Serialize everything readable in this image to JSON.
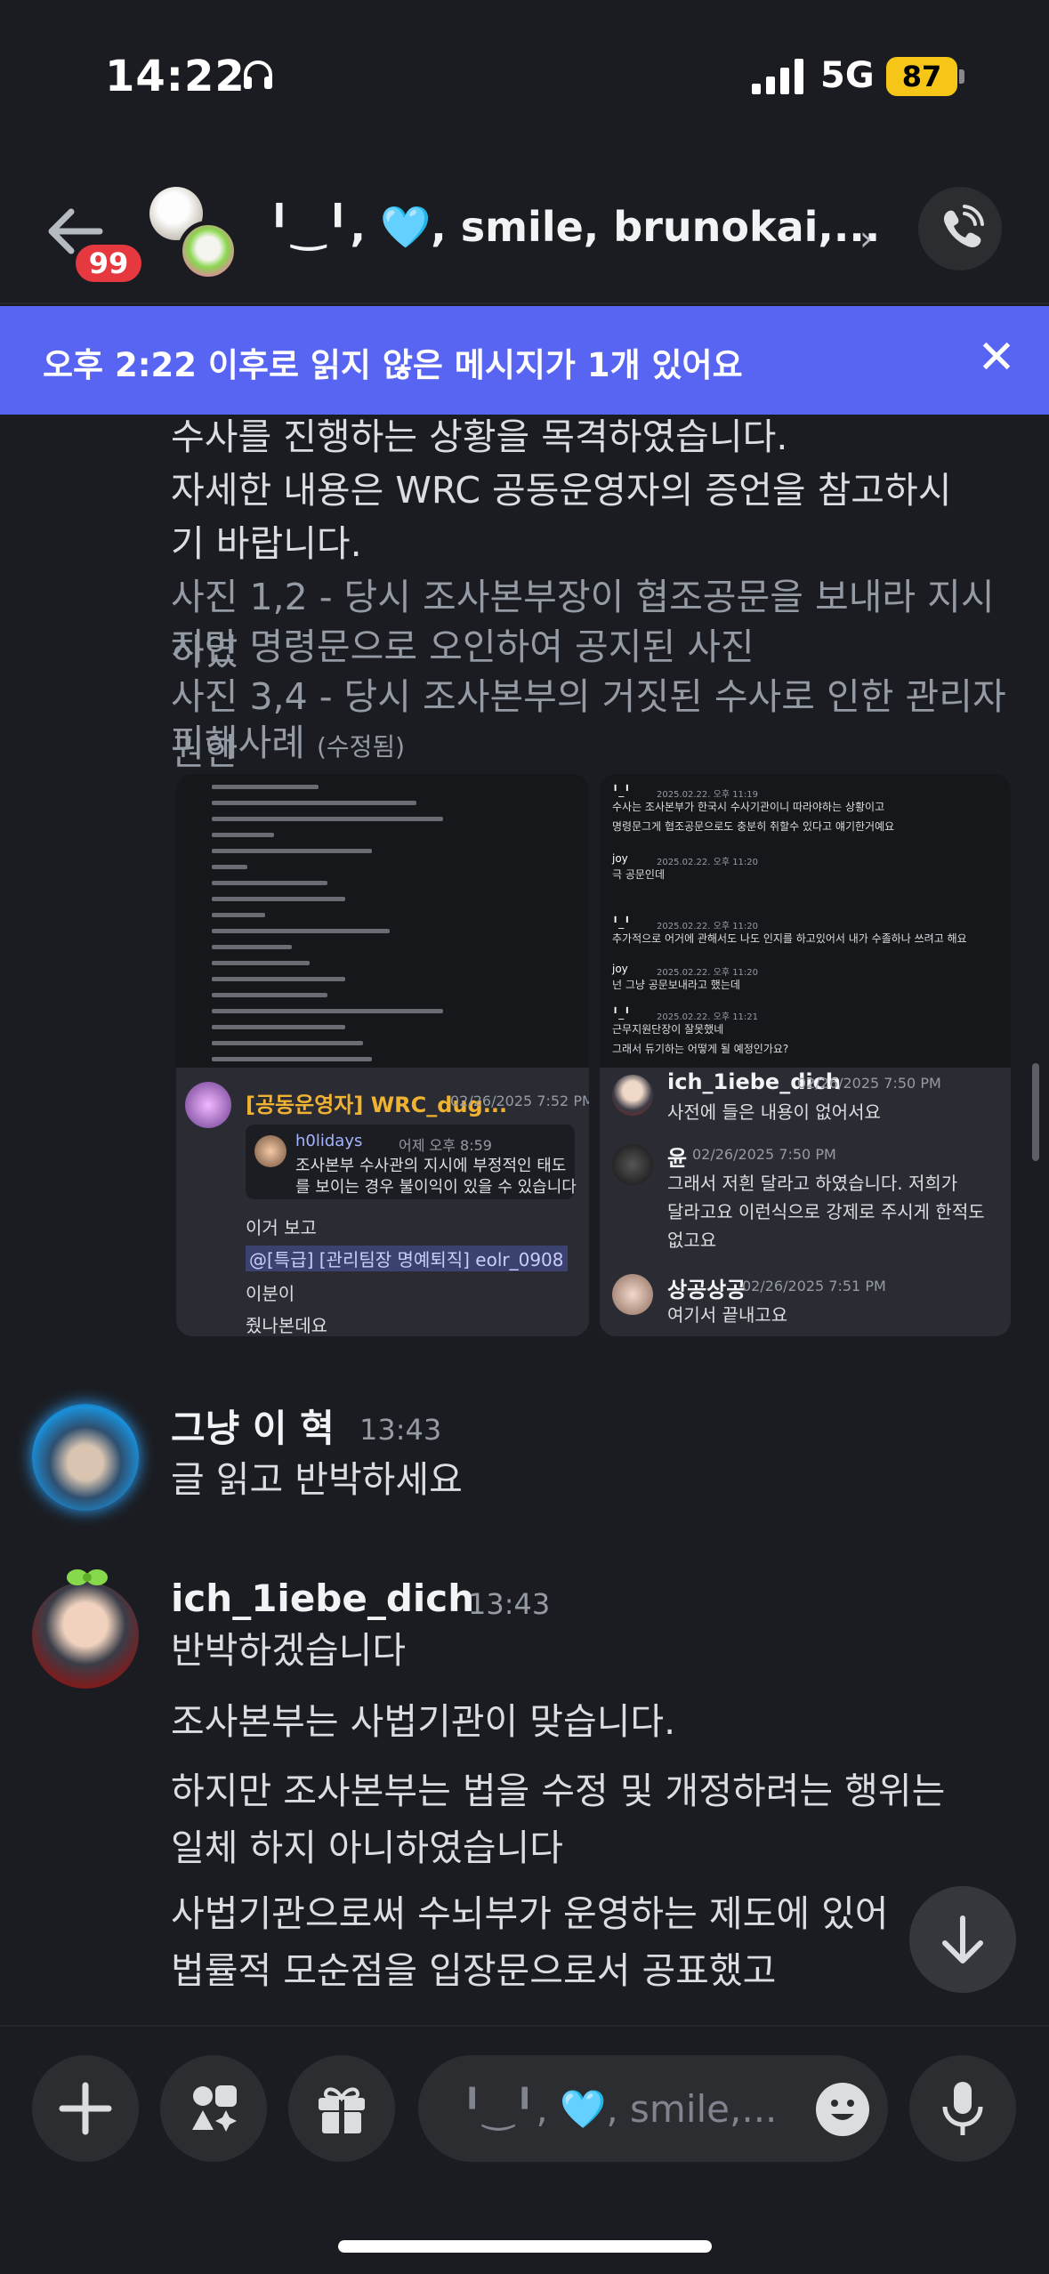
{
  "status_bar": {
    "time": "14:22",
    "network": "5G",
    "battery": "87"
  },
  "header": {
    "unread_badge": "99",
    "title": "╹‿╹, 🩵, smile, brunokai,...",
    "chevron": "›"
  },
  "unread_banner": {
    "text": "오후 2:22 이후로 읽지 않은 메시지가 1개 있어요",
    "close": "✕"
  },
  "previous_message": {
    "lines": [
      "수사를 진행하는 상황을 목격하였습니다.",
      "자세한 내용은 WRC 공동운영자의 증언을 참고하시",
      "기 바랍니다."
    ],
    "muted_lines": [
      "사진 1,2 - 당시 조사본부장이 협조공문을 보내라 지시하였",
      "지만 명령문으로 오인하여 공지된 사진",
      "사진 3,4 - 당시 조사본부의 거짓된 수사로 인한 관리자권한",
      "피해사례"
    ],
    "edited": "(수정됨)"
  },
  "attachment_left": {
    "author": "[공동운영자] WRC_dug...",
    "time": "02/26/2025 7:52 PM",
    "reply_name": "h0lidays",
    "reply_meta": "어제 오후 8:59",
    "reply_text_1": "조사본부 수사관의 지시에 부정적인 태도",
    "reply_text_2": "를 보이는 경우 불이익이 있을 수 있습니다",
    "line1": "이거 보고",
    "mention": "@[특급] [관리팀장 명예퇴직] eolr_0908",
    "line3": "이분이",
    "line4": "줬나본데요"
  },
  "attachment_right": {
    "top_rows": [
      {
        "name": "╹_╹",
        "time": "2025.02.22. 오후 11:19",
        "text": "수사는 조사본부가 한국시 수사기관이니 따라야하는 상황이고"
      },
      {
        "name": "",
        "time": "",
        "text": "명령문그게 협조공문으로도 충분히 취할수 있다고 얘기한거예요"
      },
      {
        "name": "joy",
        "time": "2025.02.22. 오후 11:20",
        "text": "극 공문인데"
      },
      {
        "name": "╹_╹",
        "time": "2025.02.22. 오후 11:20",
        "text": "추가적으로 어거에 관해서도 나도 인지를 하고있어서 내가 수졸하나 쓰려고 해요"
      },
      {
        "name": "joy",
        "time": "2025.02.22. 오후 11:20",
        "text": "넌 그냥 공문보내라고 했는데"
      },
      {
        "name": "╹_╹",
        "time": "2025.02.22. 오후 11:21",
        "text": "근무지원단장이 잘못했네"
      },
      {
        "name": "",
        "time": "",
        "text": "그래서 듀기하는 어떻게 될 예정인가요?"
      }
    ],
    "messages": [
      {
        "author": "ich_1iebe_dich",
        "time": "02/26/2025 7:50 PM",
        "lines": [
          "사전에 들은 내용이 없어서요"
        ]
      },
      {
        "author": "윤",
        "time": "02/26/2025 7:50 PM",
        "lines": [
          "그래서 저흰 달라고 하였습니다. 저희가",
          "달라고요 이런식으로 강제로 주시게 한적도",
          "없고요"
        ]
      },
      {
        "author": "상공상공",
        "time": "02/26/2025 7:51 PM",
        "lines": [
          "여기서 끝내고요"
        ]
      }
    ]
  },
  "messages": [
    {
      "author": "그냥 이 혁",
      "time": "13:43",
      "lines": [
        "글 읽고 반박하세요"
      ]
    },
    {
      "author": "ich_1iebe_dich",
      "time": "13:43",
      "lines": [
        "반박하겠습니다",
        "조사본부는 사법기관이 맞습니다.",
        "하지만 조사본부는 법을 수정 및 개정하려는 행위는",
        "일체 하지 아니하였습니다",
        "사법기관으로써 수뇌부가 운영하는 제도에 있어",
        "법률적 모순점을 입장문으로서 공표했고"
      ]
    }
  ],
  "composer": {
    "placeholder": "╹‿╹, 🩵, smile,..."
  },
  "colors": {
    "accent": "#5865f2",
    "badge": "#e5393f",
    "battery": "#f5c518",
    "mention_bg": "#3c4270",
    "left_author": "#f0b232"
  }
}
